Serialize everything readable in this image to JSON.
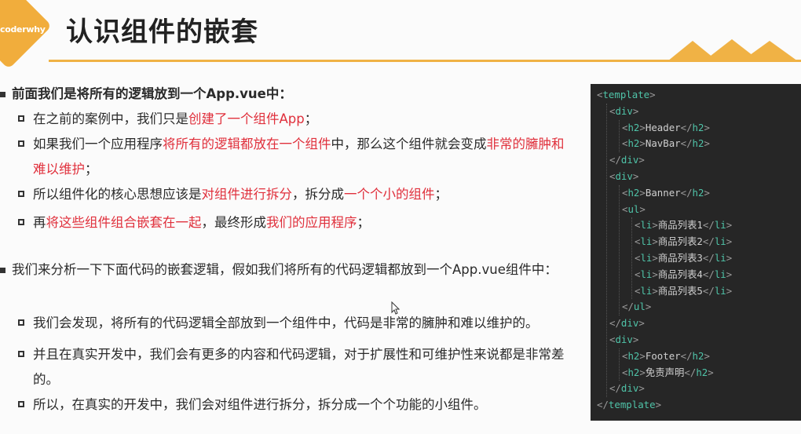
{
  "header": {
    "logo_text": "coderwhy",
    "title": "认识组件的嵌套"
  },
  "sections": [
    {
      "text": "前面我们是将所有的逻辑放到一个App.vue中：",
      "items": [
        [
          {
            "t": "在之前的案例中，我们只是"
          },
          {
            "t": "创建了一个组件App",
            "hl": true
          },
          {
            "t": "；"
          }
        ],
        [
          {
            "t": "如果我们一个应用程序"
          },
          {
            "t": "将所有的逻辑都放在一个组件",
            "hl": true
          },
          {
            "t": "中，那么这个组件就会变成"
          },
          {
            "t": "非常的臃肿和难以维护",
            "hl": true
          },
          {
            "t": "；"
          }
        ],
        [
          {
            "t": "所以组件化的核心思想应该是"
          },
          {
            "t": "对组件进行拆分",
            "hl": true
          },
          {
            "t": "，拆分成"
          },
          {
            "t": "一个个小的组件",
            "hl": true
          },
          {
            "t": "；"
          }
        ],
        [
          {
            "t": "再"
          },
          {
            "t": "将这些组件组合嵌套在一起",
            "hl": true
          },
          {
            "t": "，最终形成"
          },
          {
            "t": "我们的应用程序",
            "hl": true
          },
          {
            "t": "；"
          }
        ]
      ]
    },
    {
      "text": "我们来分析一下下面代码的嵌套逻辑，假如我们将所有的代码逻辑都放到一个App.vue组件中：",
      "items": [
        [
          {
            "t": "我们会发现，将所有的代码逻辑全部放到一个组件中，代码是非常的臃肿和难以维护的。"
          }
        ],
        [
          {
            "t": "并且在真实开发中，我们会有更多的内容和代码逻辑，对于扩展性和可维护性来说都是非常差的。"
          }
        ],
        [
          {
            "t": "所以，在真实的开发中，我们会对组件进行拆分，拆分成一个个功能的小组件。"
          }
        ]
      ]
    }
  ],
  "code": [
    {
      "indent": 0,
      "tag": "template",
      "close": false,
      "text": ""
    },
    {
      "indent": 1,
      "tag": "div",
      "close": false,
      "text": ""
    },
    {
      "indent": 2,
      "tag": "h2",
      "inline": true,
      "text": "Header"
    },
    {
      "indent": 2,
      "tag": "h2",
      "inline": true,
      "text": "NavBar"
    },
    {
      "indent": 1,
      "tag": "div",
      "close": true,
      "text": ""
    },
    {
      "indent": 1,
      "tag": "div",
      "close": false,
      "text": ""
    },
    {
      "indent": 2,
      "tag": "h2",
      "inline": true,
      "text": "Banner"
    },
    {
      "indent": 2,
      "tag": "ul",
      "close": false,
      "text": ""
    },
    {
      "indent": 3,
      "tag": "li",
      "inline": true,
      "text": "商品列表1"
    },
    {
      "indent": 3,
      "tag": "li",
      "inline": true,
      "text": "商品列表2"
    },
    {
      "indent": 3,
      "tag": "li",
      "inline": true,
      "text": "商品列表3"
    },
    {
      "indent": 3,
      "tag": "li",
      "inline": true,
      "text": "商品列表4"
    },
    {
      "indent": 3,
      "tag": "li",
      "inline": true,
      "text": "商品列表5"
    },
    {
      "indent": 2,
      "tag": "ul",
      "close": true,
      "text": ""
    },
    {
      "indent": 1,
      "tag": "div",
      "close": true,
      "text": ""
    },
    {
      "indent": 1,
      "tag": "div",
      "close": false,
      "text": ""
    },
    {
      "indent": 2,
      "tag": "h2",
      "inline": true,
      "text": "Footer"
    },
    {
      "indent": 2,
      "tag": "h2",
      "inline": true,
      "text": "免责声明"
    },
    {
      "indent": 1,
      "tag": "div",
      "close": true,
      "text": ""
    },
    {
      "indent": 0,
      "tag": "template",
      "close": true,
      "text": ""
    }
  ],
  "colors": {
    "accent": "#f1ad3c",
    "highlight": "#e0303c",
    "code_bg": "#262626",
    "code_tag": "#4fc3a8"
  }
}
